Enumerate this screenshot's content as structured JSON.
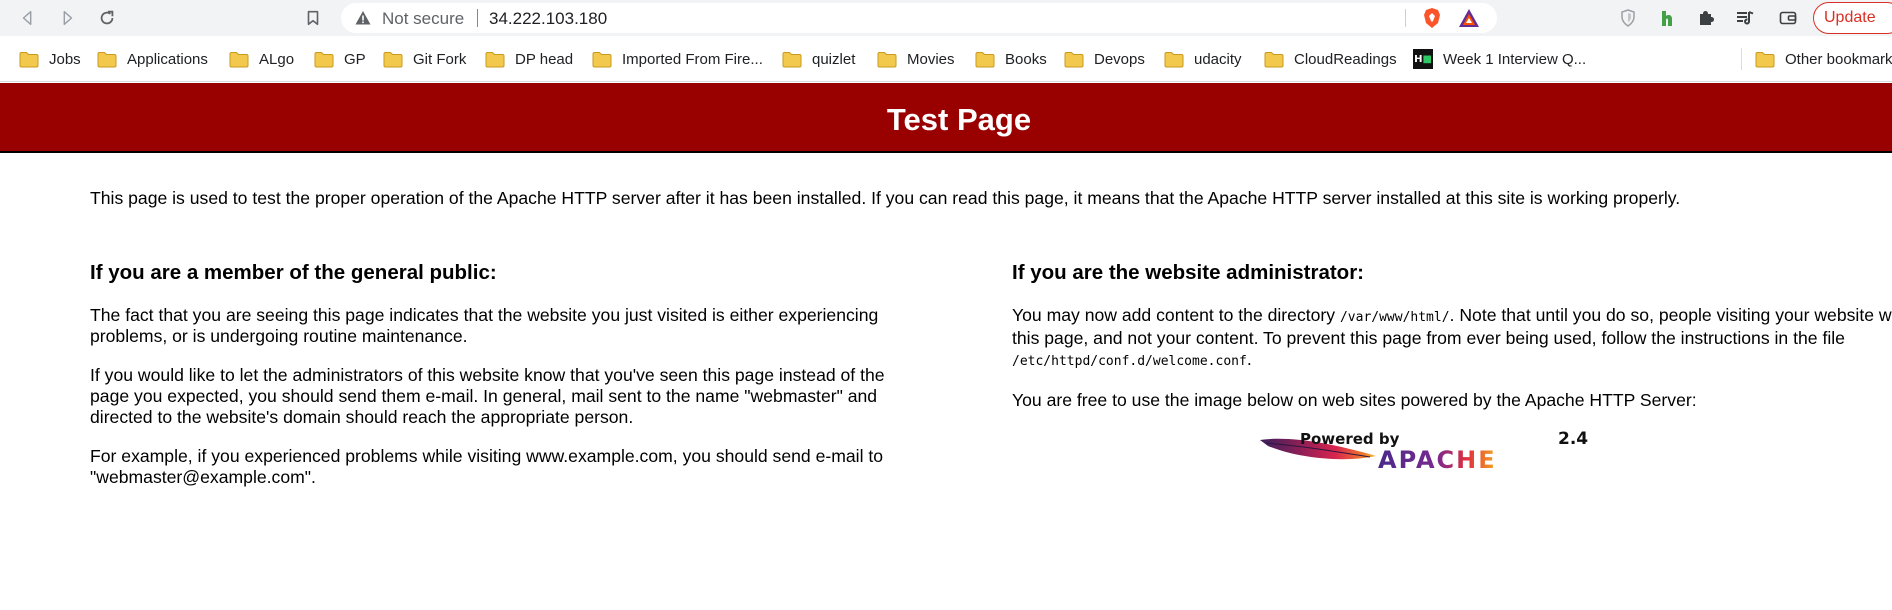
{
  "browser": {
    "address": {
      "security_label": "Not secure",
      "url": "34.222.103.180"
    },
    "update_label": "Update",
    "bookmarks": [
      {
        "label": "Jobs",
        "type": "folder"
      },
      {
        "label": "Applications",
        "type": "folder"
      },
      {
        "label": "ALgo",
        "type": "folder"
      },
      {
        "label": "GP",
        "type": "folder"
      },
      {
        "label": "Git Fork",
        "type": "folder"
      },
      {
        "label": "DP head",
        "type": "folder"
      },
      {
        "label": "Imported From Fire...",
        "type": "folder"
      },
      {
        "label": "quizlet",
        "type": "folder"
      },
      {
        "label": "Movies",
        "type": "folder"
      },
      {
        "label": "Books",
        "type": "folder"
      },
      {
        "label": "Devops",
        "type": "folder"
      },
      {
        "label": "udacity",
        "type": "folder"
      },
      {
        "label": "CloudReadings",
        "type": "folder"
      },
      {
        "label": "Week 1 Interview Q...",
        "type": "link",
        "icon": "hackerrank-icon"
      },
      {
        "label": "Other bookmarks",
        "type": "folder"
      }
    ],
    "colors": {
      "toolbar_bg": "#f1f3f4",
      "update_accent": "#d93025",
      "folder_yellow": "#f2c94c"
    }
  },
  "page": {
    "title": "Test Page",
    "intro": "This page is used to test the proper operation of the Apache HTTP server after it has been installed. If you can read this page, it means that the Apache HTTP server installed at this site is working properly.",
    "public": {
      "heading": "If you are a member of the general public:",
      "p1": "The fact that you are seeing this page indicates that the website you just visited is either experiencing problems, or is undergoing routine maintenance.",
      "p2": "If you would like to let the administrators of this website know that you've seen this page instead of the page you expected, you should send them e-mail. In general, mail sent to the name \"webmaster\" and directed to the website's domain should reach the appropriate person.",
      "p3": "For example, if you experienced problems while visiting www.example.com, you should send e-mail to \"webmaster@example.com\"."
    },
    "admin": {
      "heading": "If you are the website administrator:",
      "p1_a": "You may now add content to the directory ",
      "p1_path1": "/var/www/html/",
      "p1_b": ". Note that until you do so, people visiting your website will see this page, and not your content. To prevent this page from ever being used, follow the instructions in the file ",
      "p1_path2": "/etc/httpd/conf.d/welcome.conf",
      "p1_c": ".",
      "p2": "You are free to use the image below on web sites powered by the Apache HTTP Server:"
    },
    "logo": {
      "powered_by": "Powered by",
      "brand": "APACHE",
      "version": "2.4"
    },
    "colors": {
      "header_bg": "#990000",
      "header_text": "#ffffff"
    }
  }
}
